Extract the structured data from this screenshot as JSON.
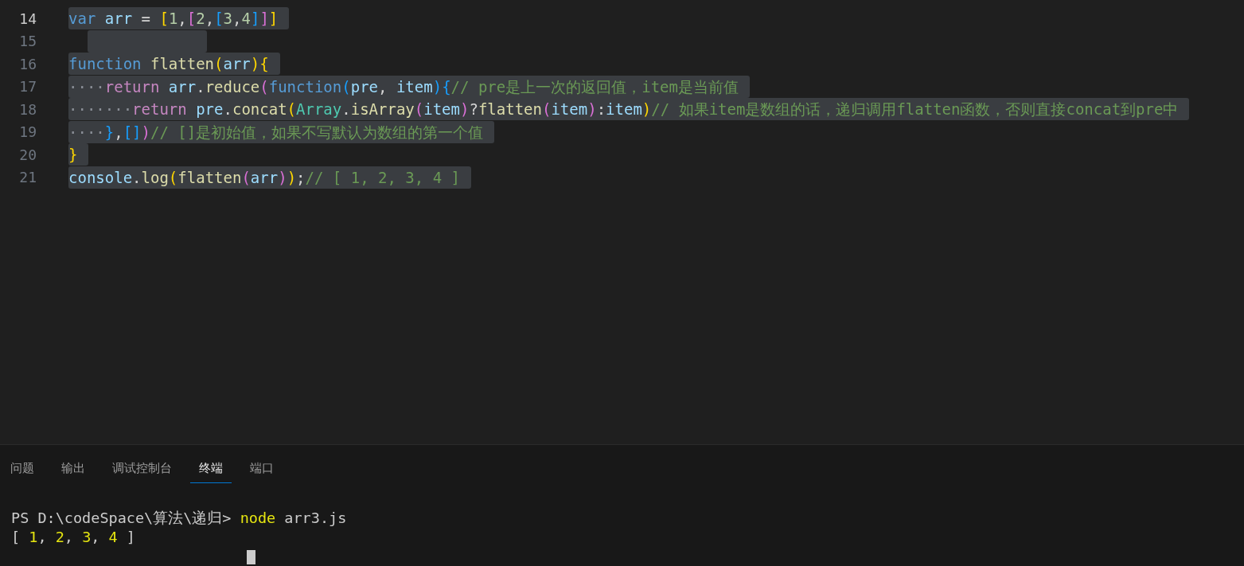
{
  "editor": {
    "lines": [
      {
        "number": "14",
        "current": true,
        "tokens": [
          {
            "text": "var ",
            "kind": "keyword"
          },
          {
            "text": "arr",
            "kind": "var"
          },
          {
            "text": " = ",
            "kind": "op"
          },
          {
            "text": "[",
            "kind": "b1"
          },
          {
            "text": "1",
            "kind": "number"
          },
          {
            "text": ",",
            "kind": "op"
          },
          {
            "text": "[",
            "kind": "b2"
          },
          {
            "text": "2",
            "kind": "number"
          },
          {
            "text": ",",
            "kind": "op"
          },
          {
            "text": "[",
            "kind": "b3"
          },
          {
            "text": "3",
            "kind": "number"
          },
          {
            "text": ",",
            "kind": "op"
          },
          {
            "text": "4",
            "kind": "number"
          },
          {
            "text": "]",
            "kind": "b3"
          },
          {
            "text": "]",
            "kind": "b2"
          },
          {
            "text": "]",
            "kind": "b1"
          }
        ]
      },
      {
        "number": "15",
        "current": false
      },
      {
        "number": "16",
        "current": false,
        "tokens": [
          {
            "text": "function ",
            "kind": "keyword"
          },
          {
            "text": "flatten",
            "kind": "fn"
          },
          {
            "text": "(",
            "kind": "b1"
          },
          {
            "text": "arr",
            "kind": "var"
          },
          {
            "text": ")",
            "kind": "b1"
          },
          {
            "text": "{",
            "kind": "b1"
          }
        ]
      },
      {
        "number": "17",
        "current": false,
        "tokens": [
          {
            "text": "····",
            "kind": "ws"
          },
          {
            "text": "return ",
            "kind": "control"
          },
          {
            "text": "arr",
            "kind": "var"
          },
          {
            "text": ".",
            "kind": "op"
          },
          {
            "text": "reduce",
            "kind": "fn"
          },
          {
            "text": "(",
            "kind": "b2"
          },
          {
            "text": "function",
            "kind": "keyword"
          },
          {
            "text": "(",
            "kind": "b3"
          },
          {
            "text": "pre",
            "kind": "var"
          },
          {
            "text": ", ",
            "kind": "op"
          },
          {
            "text": "item",
            "kind": "var"
          },
          {
            "text": ")",
            "kind": "b3"
          },
          {
            "text": "{",
            "kind": "b3"
          },
          {
            "text": "// pre是上一次的返回值，item是当前值",
            "kind": "comment"
          }
        ]
      },
      {
        "number": "18",
        "current": false,
        "tokens": [
          {
            "text": "·······",
            "kind": "ws"
          },
          {
            "text": "return ",
            "kind": "control"
          },
          {
            "text": "pre",
            "kind": "var"
          },
          {
            "text": ".",
            "kind": "op"
          },
          {
            "text": "concat",
            "kind": "fn"
          },
          {
            "text": "(",
            "kind": "b1"
          },
          {
            "text": "Array",
            "kind": "class"
          },
          {
            "text": ".",
            "kind": "op"
          },
          {
            "text": "isArray",
            "kind": "fn"
          },
          {
            "text": "(",
            "kind": "b2"
          },
          {
            "text": "item",
            "kind": "var"
          },
          {
            "text": ")",
            "kind": "b2"
          },
          {
            "text": "?",
            "kind": "op"
          },
          {
            "text": "flatten",
            "kind": "fn"
          },
          {
            "text": "(",
            "kind": "b2"
          },
          {
            "text": "item",
            "kind": "var"
          },
          {
            "text": ")",
            "kind": "b2"
          },
          {
            "text": ":",
            "kind": "op"
          },
          {
            "text": "item",
            "kind": "var"
          },
          {
            "text": ")",
            "kind": "b1"
          },
          {
            "text": "// 如果item是数组的话，递归调用flatten函数，否则直接concat到pre中",
            "kind": "comment"
          }
        ]
      },
      {
        "number": "19",
        "current": false,
        "tokens": [
          {
            "text": "····",
            "kind": "ws"
          },
          {
            "text": "}",
            "kind": "b3"
          },
          {
            "text": ",",
            "kind": "op"
          },
          {
            "text": "[]",
            "kind": "b3"
          },
          {
            "text": ")",
            "kind": "b2"
          },
          {
            "text": "// []是初始值，如果不写默认为数组的第一个值",
            "kind": "comment"
          }
        ]
      },
      {
        "number": "20",
        "current": false,
        "tokens": [
          {
            "text": "}",
            "kind": "b1"
          }
        ]
      },
      {
        "number": "21",
        "current": false,
        "tokens": [
          {
            "text": "console",
            "kind": "var"
          },
          {
            "text": ".",
            "kind": "op"
          },
          {
            "text": "log",
            "kind": "fn"
          },
          {
            "text": "(",
            "kind": "b1"
          },
          {
            "text": "flatten",
            "kind": "fn"
          },
          {
            "text": "(",
            "kind": "b2"
          },
          {
            "text": "arr",
            "kind": "var"
          },
          {
            "text": ")",
            "kind": "b2"
          },
          {
            "text": ")",
            "kind": "b1"
          },
          {
            "text": ";",
            "kind": "op"
          },
          {
            "text": "// [ 1, 2, 3, 4 ]",
            "kind": "comment"
          }
        ]
      }
    ]
  },
  "panel": {
    "tabs": [
      {
        "label": "问题",
        "selected": false
      },
      {
        "label": "输出",
        "selected": false
      },
      {
        "label": "调试控制台",
        "selected": false
      },
      {
        "label": "终端",
        "selected": true
      },
      {
        "label": "端口",
        "selected": false
      }
    ],
    "terminal": {
      "prompt": "PS D:\\codeSpace\\算法\\递归> ",
      "command": "node",
      "args": " arr3.js",
      "output": [
        {
          "text": "[ ",
          "kind": "plain"
        },
        {
          "text": "1",
          "kind": "number"
        },
        {
          "text": ", ",
          "kind": "plain"
        },
        {
          "text": "2",
          "kind": "number"
        },
        {
          "text": ", ",
          "kind": "plain"
        },
        {
          "text": "3",
          "kind": "number"
        },
        {
          "text": ", ",
          "kind": "plain"
        },
        {
          "text": "4",
          "kind": "number"
        },
        {
          "text": " ]",
          "kind": "plain"
        }
      ]
    }
  }
}
